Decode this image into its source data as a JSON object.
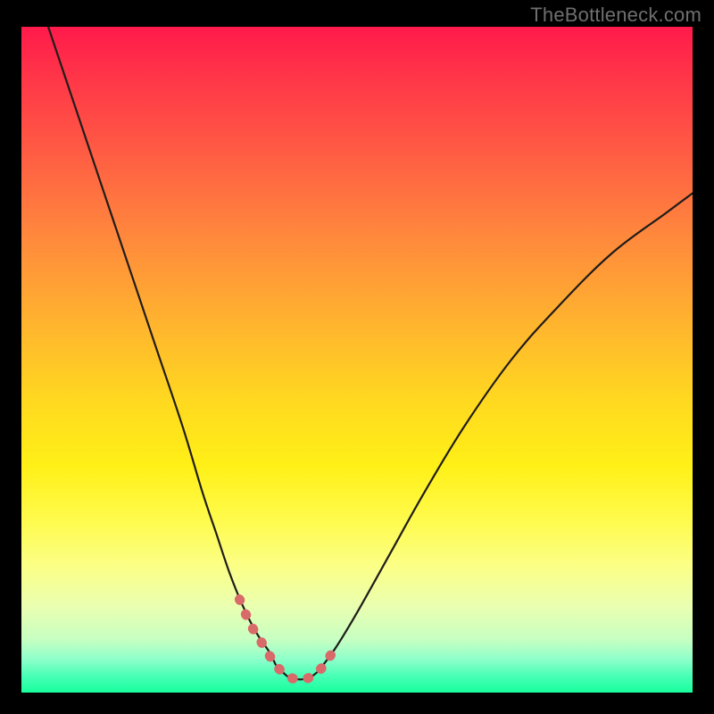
{
  "attribution": "TheBottleneck.com",
  "chart_data": {
    "type": "line",
    "title": "",
    "xlabel": "",
    "ylabel": "",
    "xlim": [
      0,
      100
    ],
    "ylim": [
      0,
      100
    ],
    "series": [
      {
        "name": "bottleneck-curve",
        "x": [
          4,
          8,
          12,
          16,
          20,
          24,
          27,
          29,
          31,
          33,
          35,
          37,
          38,
          39,
          40,
          41,
          42,
          43,
          44,
          45,
          47,
          50,
          55,
          60,
          66,
          73,
          80,
          88,
          96,
          100
        ],
        "y": [
          100,
          88,
          76,
          64,
          52,
          40,
          30,
          24,
          18,
          13,
          9,
          6,
          4,
          3,
          2.2,
          2,
          2,
          2.3,
          3,
          4.2,
          7,
          12,
          21,
          30,
          40,
          50,
          58,
          66,
          72,
          75
        ]
      },
      {
        "name": "highlight-segment",
        "x": [
          32.5,
          34,
          35.5,
          37,
          38,
          39,
          40,
          41,
          42,
          43,
          44,
          45,
          46,
          47.3
        ],
        "y": [
          14,
          10.5,
          8,
          5.5,
          4,
          3,
          2.3,
          2,
          2,
          2.3,
          3,
          4,
          5.5,
          7.5
        ]
      }
    ]
  },
  "colors": {
    "gradient_top": "#ff1a4b",
    "gradient_mid": "#ffe617",
    "gradient_bottom": "#18ff9d",
    "curve": "#1f1c1a",
    "highlight": "#d96a6a",
    "background": "#000000",
    "attribution_text": "#6f6f6f"
  }
}
